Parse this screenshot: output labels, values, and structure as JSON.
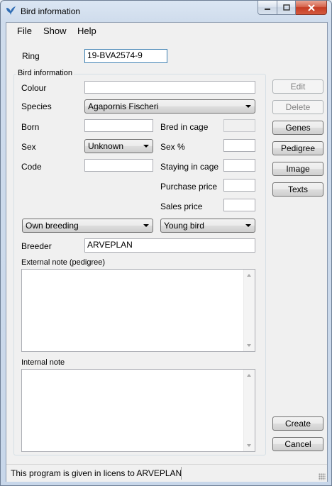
{
  "window": {
    "title": "Bird information",
    "icon": "bird-icon"
  },
  "menu": {
    "file": "File",
    "show": "Show",
    "help": "Help"
  },
  "ring": {
    "label": "Ring",
    "value": "19-BVA2574-9"
  },
  "group_title": "Bird information",
  "fields": {
    "colour_label": "Colour",
    "colour_value": "",
    "species_label": "Species",
    "species_value": "Agapornis Fischeri",
    "born_label": "Born",
    "born_value": "",
    "bred_in_cage_label": "Bred in cage",
    "bred_in_cage_value": "",
    "sex_label": "Sex",
    "sex_value": "Unknown",
    "sex_pct_label": "Sex %",
    "sex_pct_value": "",
    "code_label": "Code",
    "code_value": "",
    "staying_label": "Staying in cage",
    "staying_value": "",
    "purchase_label": "Purchase price",
    "purchase_value": "",
    "sales_label": "Sales price",
    "sales_value": "",
    "origin_value": "Own breeding",
    "age_value": "Young bird",
    "breeder_label": "Breeder",
    "breeder_value": "ARVEPLAN",
    "external_note_label": "External note (pedigree)",
    "internal_note_label": "Internal note"
  },
  "buttons": {
    "edit": "Edit",
    "delete": "Delete",
    "genes": "Genes",
    "pedigree": "Pedigree",
    "image": "Image",
    "texts": "Texts",
    "create": "Create",
    "cancel": "Cancel"
  },
  "status": {
    "text": "This program is given in licens to ARVEPLAN"
  }
}
